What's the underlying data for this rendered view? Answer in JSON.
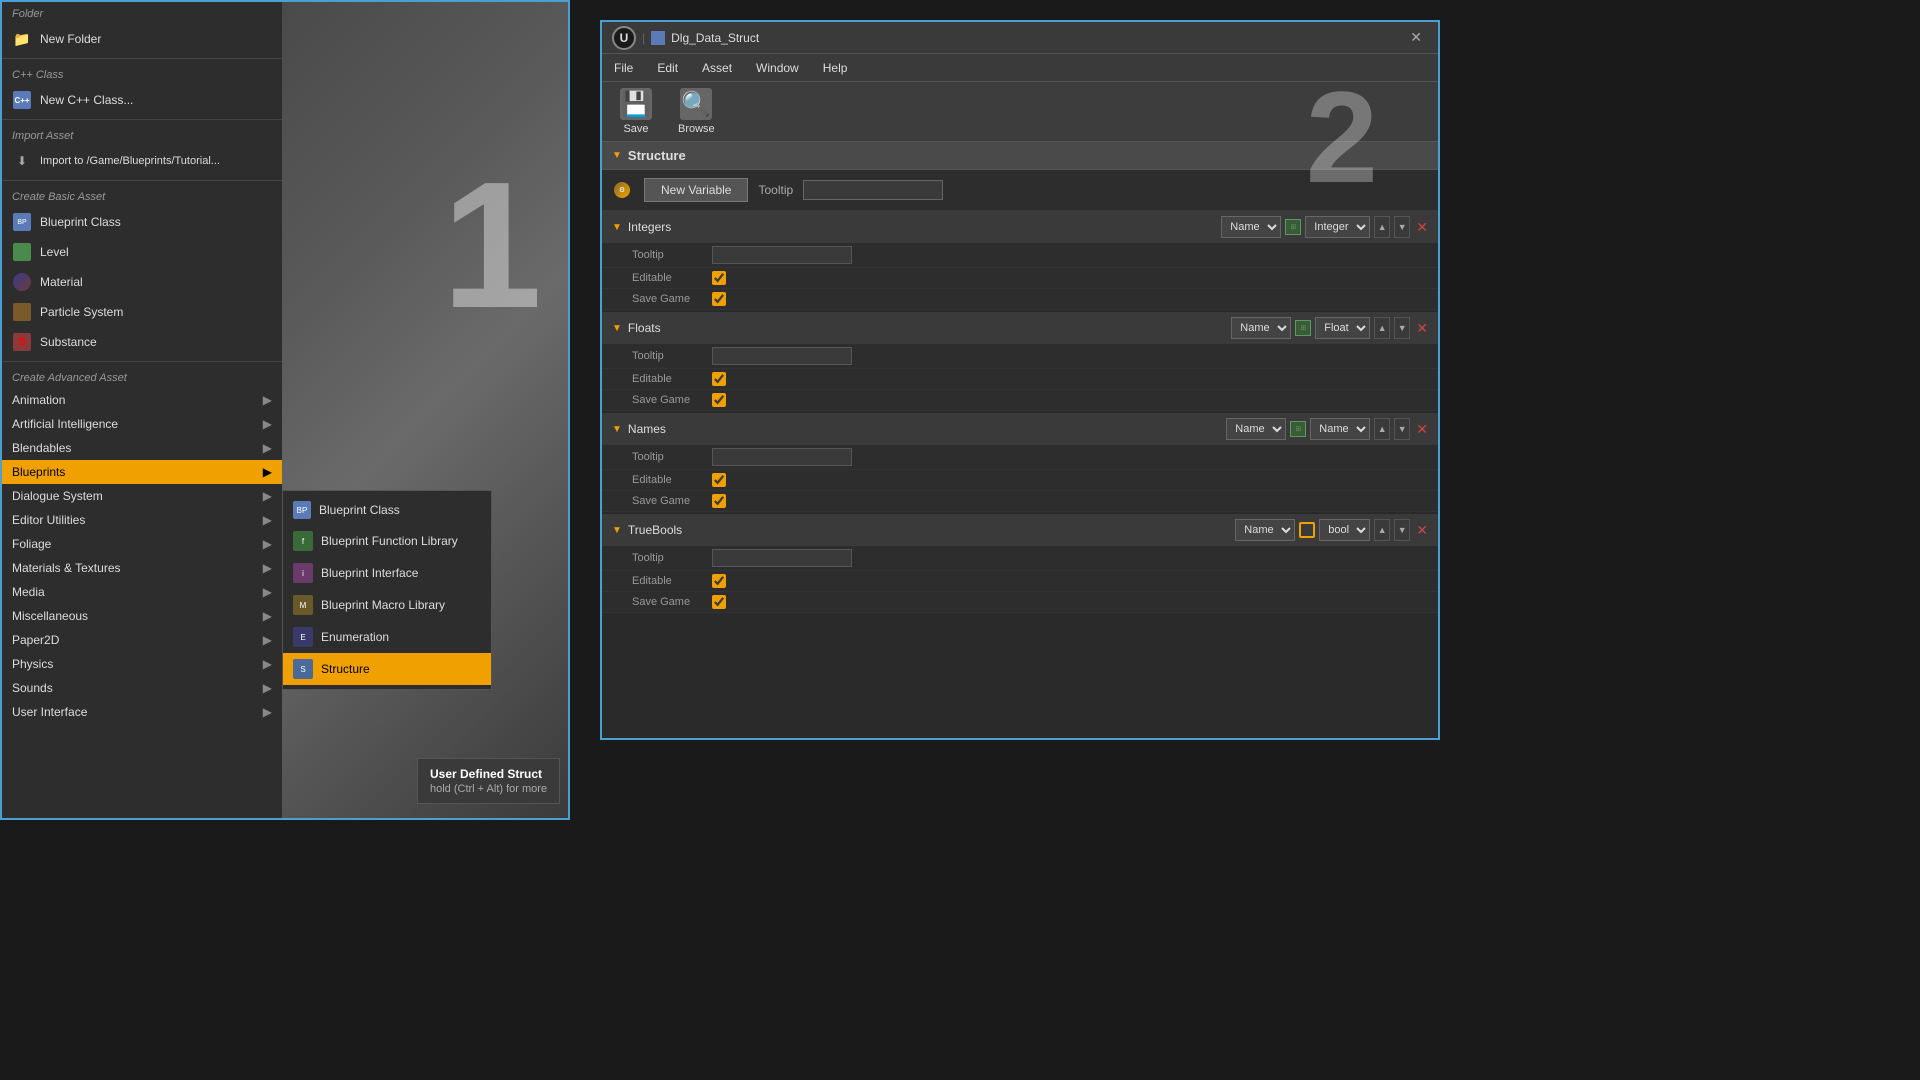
{
  "left_panel": {
    "folder_section": "Folder",
    "folder_item": "New Folder",
    "cpp_section": "C++ Class",
    "cpp_item": "New C++ Class...",
    "import_section": "Import Asset",
    "import_item": "Import to /Game/Blueprints/Tutorial...",
    "basic_section": "Create Basic Asset",
    "basic_items": [
      {
        "label": "Blueprint Class",
        "icon": "bp-class"
      },
      {
        "label": "Level",
        "icon": "level"
      },
      {
        "label": "Material",
        "icon": "material"
      },
      {
        "label": "Particle System",
        "icon": "particle"
      },
      {
        "label": "Substance",
        "icon": "substance"
      }
    ],
    "advanced_section": "Create Advanced Asset",
    "advanced_items": [
      {
        "label": "Animation",
        "has_arrow": true
      },
      {
        "label": "Artificial Intelligence",
        "has_arrow": true
      },
      {
        "label": "Blendables",
        "has_arrow": true
      },
      {
        "label": "Blueprints",
        "has_arrow": true,
        "highlighted": true
      },
      {
        "label": "Dialogue System",
        "has_arrow": true
      },
      {
        "label": "Editor Utilities",
        "has_arrow": true
      },
      {
        "label": "Foliage",
        "has_arrow": true
      },
      {
        "label": "Materials & Textures",
        "has_arrow": true
      },
      {
        "label": "Media",
        "has_arrow": true
      },
      {
        "label": "Miscellaneous",
        "has_arrow": true
      },
      {
        "label": "Paper2D",
        "has_arrow": true
      },
      {
        "label": "Physics",
        "has_arrow": true
      },
      {
        "label": "Sounds",
        "has_arrow": true
      },
      {
        "label": "User Interface",
        "has_arrow": true
      }
    ],
    "number_1": "1"
  },
  "blueprints_submenu": {
    "items": [
      {
        "label": "Blueprint Class",
        "icon": "bp-class-sub"
      },
      {
        "label": "Blueprint Function Library",
        "icon": "bp-func"
      },
      {
        "label": "Blueprint Interface",
        "icon": "bp-iface"
      },
      {
        "label": "Blueprint Macro Library",
        "icon": "bp-macro"
      },
      {
        "label": "Enumeration",
        "icon": "enum"
      },
      {
        "label": "Structure",
        "icon": "struct-sub",
        "highlighted": true
      }
    ]
  },
  "tooltip": {
    "title": "User Defined Struct",
    "subtitle": "hold (Ctrl + Alt) for more"
  },
  "right_panel": {
    "title": "Dlg_Data_Struct",
    "menu_items": [
      "File",
      "Edit",
      "Asset",
      "Window",
      "Help"
    ],
    "toolbar": {
      "save_label": "Save",
      "browse_label": "Browse",
      "number_2": "2"
    },
    "structure_title": "Structure",
    "new_variable_btn": "New Variable",
    "tooltip_label": "Tooltip",
    "variable_groups": [
      {
        "name": "Integers",
        "name_type": "Name",
        "array_type": "Integer",
        "type_badge": "integer",
        "tooltip": "",
        "editable": true,
        "save_game": true
      },
      {
        "name": "Floats",
        "name_type": "Name",
        "array_type": "Float",
        "type_badge": "float",
        "tooltip": "",
        "editable": true,
        "save_game": true
      },
      {
        "name": "Names",
        "name_type": "Name",
        "array_type": "Name",
        "type_badge": "name",
        "tooltip": "",
        "editable": true,
        "save_game": true
      },
      {
        "name": "TrueBools",
        "name_type": "Name",
        "array_type": "bool",
        "type_badge": "bool",
        "tooltip": "",
        "editable": true,
        "save_game": true
      }
    ]
  }
}
